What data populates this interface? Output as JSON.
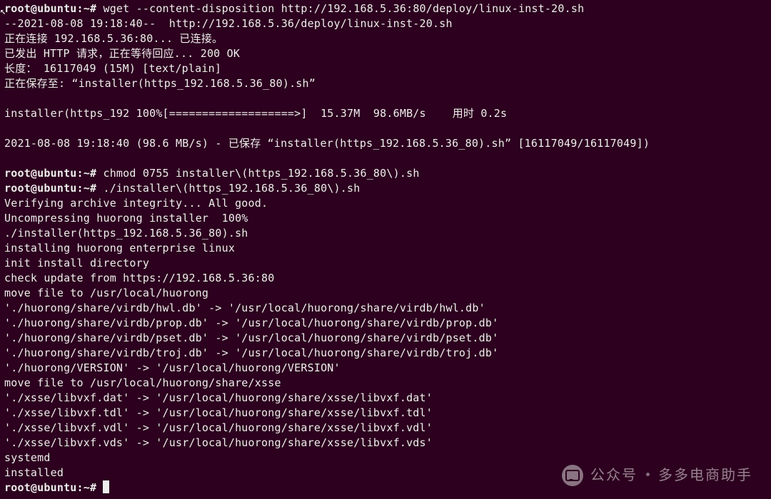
{
  "prompt": "root@ubuntu:~#",
  "lines": {
    "l1_cmd": "wget --content-disposition http://192.168.5.36:80/deploy/linux-inst-20.sh",
    "l2": "--2021-08-08 19:18:40--  http://192.168.5.36/deploy/linux-inst-20.sh",
    "l3": "正在连接 192.168.5.36:80... 已连接。",
    "l4": "已发出 HTTP 请求，正在等待回应... 200 OK",
    "l5": "长度： 16117049 (15M) [text/plain]",
    "l6": "正在保存至: “installer(https_192.168.5.36_80).sh”",
    "l7": "",
    "l8": "installer(https_192 100%[===================>]  15.37M  98.6MB/s    用时 0.2s",
    "l9": "",
    "l10": "2021-08-08 19:18:40 (98.6 MB/s) - 已保存 “installer(https_192.168.5.36_80).sh” [16117049/16117049])",
    "l11": "",
    "l12_cmd": "chmod 0755 installer\\(https_192.168.5.36_80\\).sh",
    "l13_cmd": "./installer\\(https_192.168.5.36_80\\).sh",
    "l14": "Verifying archive integrity... All good.",
    "l15": "Uncompressing huorong installer  100%",
    "l16": "./installer(https_192.168.5.36_80).sh",
    "l17": "installing huorong enterprise linux",
    "l18": "init install directory",
    "l19": "check update from https://192.168.5.36:80",
    "l20": "move file to /usr/local/huorong",
    "l21": "'./huorong/share/virdb/hwl.db' -> '/usr/local/huorong/share/virdb/hwl.db'",
    "l22": "'./huorong/share/virdb/prop.db' -> '/usr/local/huorong/share/virdb/prop.db'",
    "l23": "'./huorong/share/virdb/pset.db' -> '/usr/local/huorong/share/virdb/pset.db'",
    "l24": "'./huorong/share/virdb/troj.db' -> '/usr/local/huorong/share/virdb/troj.db'",
    "l25": "'./huorong/VERSION' -> '/usr/local/huorong/VERSION'",
    "l26": "move file to /usr/local/huorong/share/xsse",
    "l27": "'./xsse/libvxf.dat' -> '/usr/local/huorong/share/xsse/libvxf.dat'",
    "l28": "'./xsse/libvxf.tdl' -> '/usr/local/huorong/share/xsse/libvxf.tdl'",
    "l29": "'./xsse/libvxf.vdl' -> '/usr/local/huorong/share/xsse/libvxf.vdl'",
    "l30": "'./xsse/libvxf.vds' -> '/usr/local/huorong/share/xsse/libvxf.vds'",
    "l31": "systemd",
    "l32": "installed"
  },
  "watermark": {
    "label_prefix": "公众号",
    "label_suffix": "多多电商助手"
  }
}
